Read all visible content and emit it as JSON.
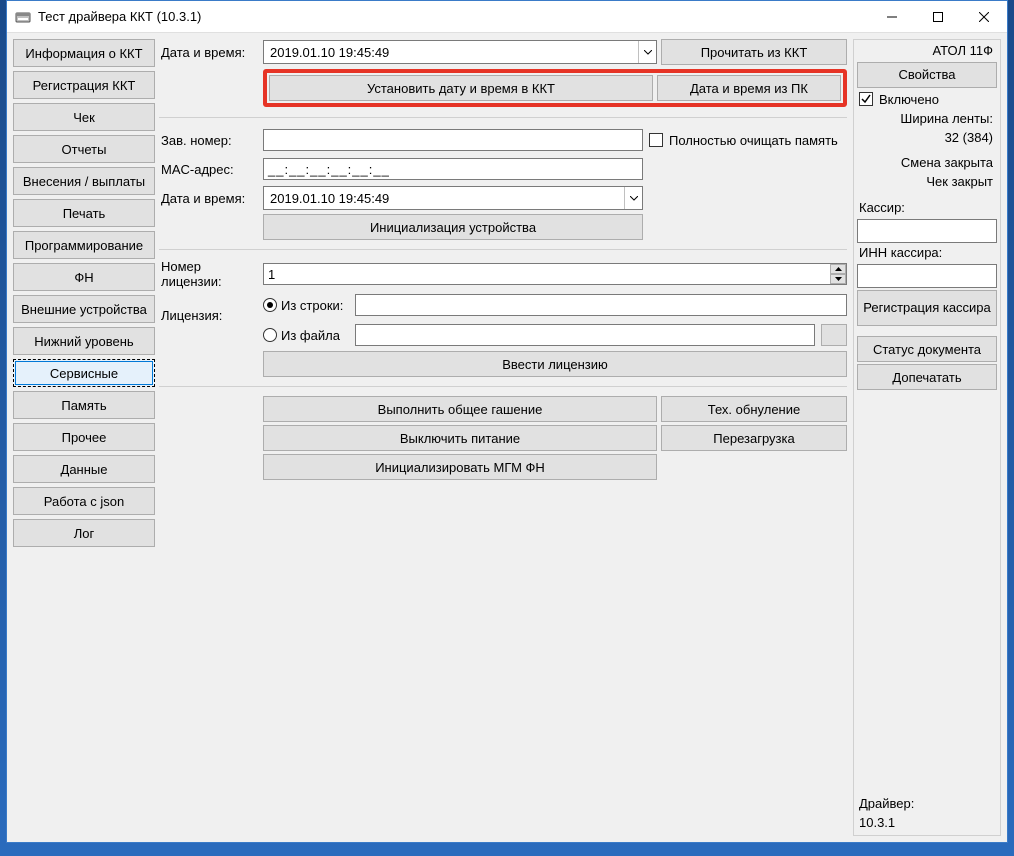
{
  "window": {
    "title": "Тест драйвера ККТ (10.3.1)"
  },
  "sidebar": {
    "items": [
      "Информация о ККТ",
      "Регистрация ККТ",
      "Чек",
      "Отчеты",
      "Внесения / выплаты",
      "Печать",
      "Программирование",
      "ФН",
      "Внешние устройства",
      "Нижний уровень",
      "Сервисные",
      "Память",
      "Прочее",
      "Данные",
      "Работа с json",
      "Лог"
    ],
    "selected_index": 10
  },
  "main": {
    "labels": {
      "datetime": "Дата и время:",
      "serial": "Зав. номер:",
      "mac": "MAC-адрес:",
      "datetime2": "Дата и время:",
      "license_no": "Номер лицензии:",
      "license": "Лицензия:"
    },
    "datetime_value": "2019.01.10 19:45:49",
    "serial_value": "",
    "mac_value": "__:__:__:__:__:__",
    "datetime2_value": "2019.01.10 19:45:49",
    "license_no_value": "1",
    "license_source": {
      "from_string": "Из строки:",
      "from_file": "Из файла",
      "string_value": "",
      "file_value": ""
    },
    "clear_memory": "Полностью очищать память",
    "buttons": {
      "read_from_kkt": "Прочитать из ККТ",
      "set_datetime": "Установить дату и время в ККТ",
      "datetime_from_pc": "Дата и время из ПК",
      "init_device": "Инициализация устройства",
      "enter_license": "Ввести лицензию",
      "general_clear": "Выполнить общее гашение",
      "tech_reset": "Тех. обнуление",
      "power_off": "Выключить питание",
      "reboot": "Перезагрузка",
      "init_mgm": "Инициализировать МГМ ФН"
    }
  },
  "right": {
    "device": "АТОЛ 11Ф",
    "properties": "Свойства",
    "enabled": "Включено",
    "tape_width_label": "Ширина ленты:",
    "tape_width_value": "32 (384)",
    "shift_status": "Смена закрыта",
    "check_status": "Чек закрыт",
    "cashier_label": "Кассир:",
    "cashier_value": "",
    "cashier_inn_label": "ИНН кассира:",
    "cashier_inn_value": "",
    "register_cashier": "Регистрация кассира",
    "doc_status": "Статус документа",
    "reprint": "Допечатать",
    "driver_label": "Драйвер:",
    "driver_version": "10.3.1"
  }
}
